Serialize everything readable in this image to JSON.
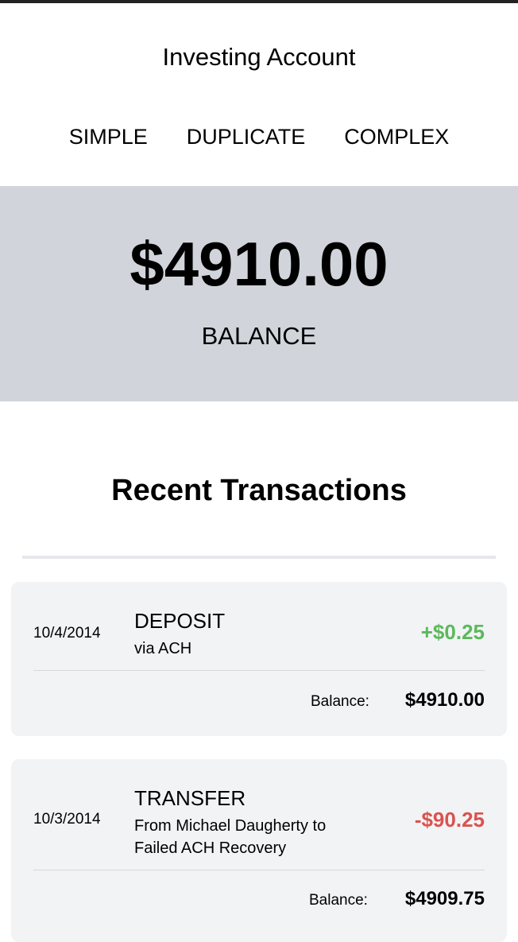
{
  "header": {
    "title": "Investing Account",
    "tabs": [
      {
        "label": "SIMPLE"
      },
      {
        "label": "DUPLICATE"
      },
      {
        "label": "COMPLEX"
      }
    ]
  },
  "balance": {
    "amount": "$4910.00",
    "label": "BALANCE"
  },
  "transactions_section": {
    "title": "Recent Transactions"
  },
  "transactions": [
    {
      "date": "10/4/2014",
      "type": "DEPOSIT",
      "description": "via ACH",
      "amount": "+$0.25",
      "balance_label": "Balance:",
      "balance_value": "$4910.00"
    },
    {
      "date": "10/3/2014",
      "type": "TRANSFER",
      "description": "From Michael Daugherty to Failed ACH Recovery",
      "amount": "-$90.25",
      "balance_label": "Balance:",
      "balance_value": "$4909.75"
    }
  ],
  "colors": {
    "positive": "#5cb85c",
    "negative": "#d9534f",
    "panel": "#d1d5db",
    "card": "#f2f3f5"
  }
}
